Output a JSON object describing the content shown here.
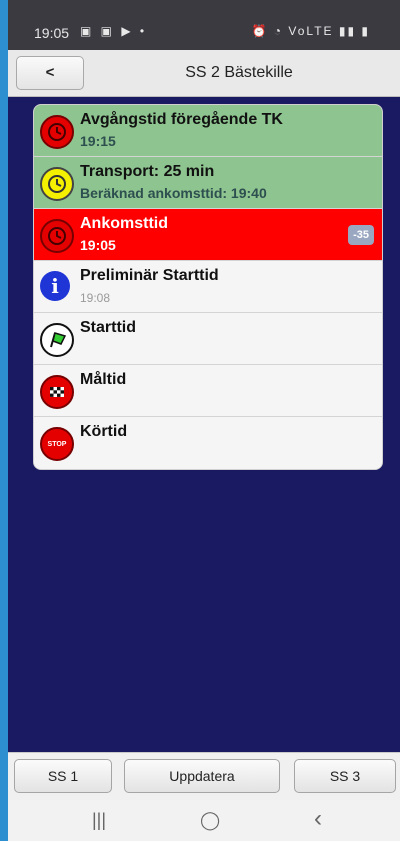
{
  "statusbar": {
    "time": "19:05",
    "left_icons": "▣ ▣ ▶ •",
    "right_icons": "⏰ ◔ VoLTE ▮▮ ▮"
  },
  "header": {
    "back_label": "<",
    "title": "SS 2 Bästekille"
  },
  "rows": [
    {
      "title": "Avgångstid föregående TK",
      "sub": "19:15",
      "style": "green",
      "icon": "clock-icon"
    },
    {
      "title": "Transport: 25 min",
      "sub": "Beräknad ankomsttid: 19:40",
      "style": "green",
      "icon": "clock-icon"
    },
    {
      "title": "Ankomsttid",
      "sub": "19:05",
      "style": "red",
      "icon": "clock-icon",
      "badge": "-35"
    },
    {
      "title": "Preliminär Starttid",
      "sub": "19:08",
      "style": "white",
      "icon": "info-icon"
    },
    {
      "title": "Starttid",
      "sub": "",
      "style": "white",
      "icon": "green-flag-icon"
    },
    {
      "title": "Måltid",
      "sub": "",
      "style": "white",
      "icon": "checkered-flag-icon"
    },
    {
      "title": "Körtid",
      "sub": "",
      "style": "white",
      "icon": "stop-icon",
      "icon_text": "STOP"
    }
  ],
  "toolbar": {
    "prev_label": "SS 1",
    "update_label": "Uppdatera",
    "next_label": "SS 3"
  },
  "navbar": {
    "recents": "|||",
    "home": "◯",
    "back": "‹"
  },
  "colors": {
    "main_bg": "#1a1a62",
    "green_row": "#8ec48f",
    "red_row": "#ff0000",
    "badge": "#9aa7c1"
  }
}
